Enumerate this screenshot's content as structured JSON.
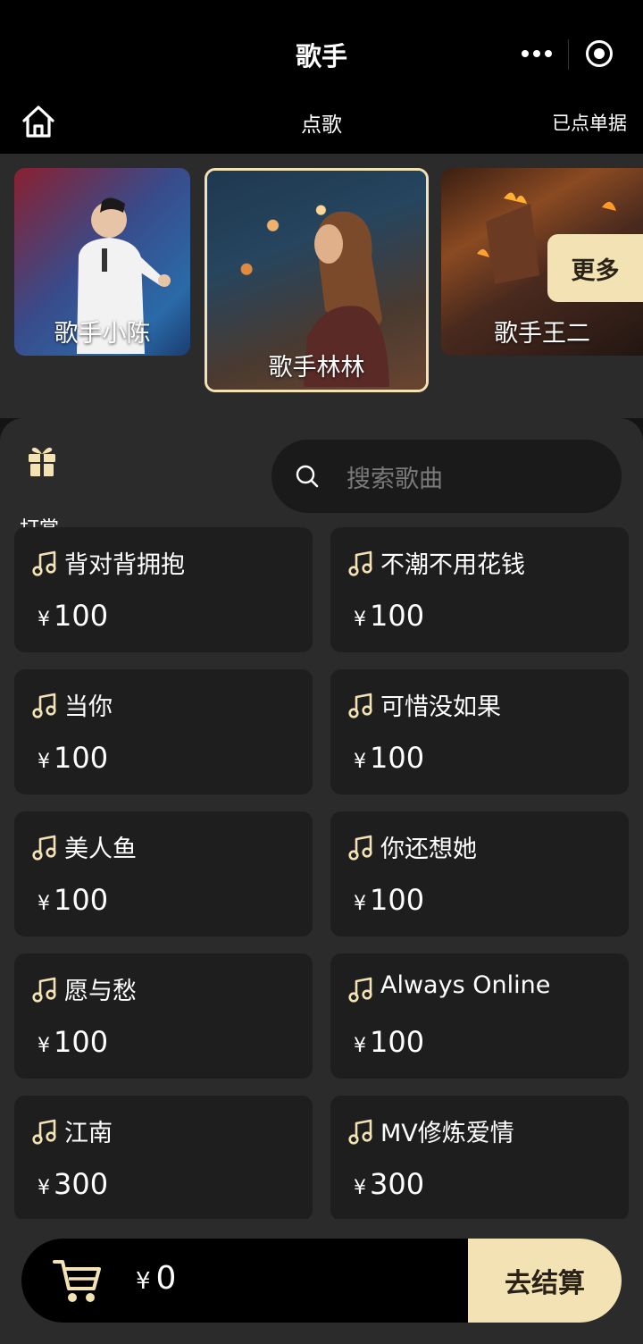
{
  "header": {
    "title": "歌手",
    "more_icon": "more-dots-icon",
    "close_icon": "target-icon"
  },
  "nav": {
    "home_icon": "home-icon",
    "title": "点歌",
    "orders_label": "已点单据"
  },
  "singers": [
    {
      "name": "歌手小陈",
      "selected": false
    },
    {
      "name": "歌手林林",
      "selected": true
    },
    {
      "name": "歌手王二",
      "selected": false
    }
  ],
  "more_label": "更多",
  "reward": {
    "label": "打赏",
    "icon": "gift-icon"
  },
  "search": {
    "placeholder": "搜索歌曲",
    "icon": "search-icon"
  },
  "songs": [
    {
      "title": "背对背拥抱",
      "currency": "¥",
      "price": "100"
    },
    {
      "title": "不潮不用花钱",
      "currency": "¥",
      "price": "100"
    },
    {
      "title": "当你",
      "currency": "¥",
      "price": "100"
    },
    {
      "title": "可惜没如果",
      "currency": "¥",
      "price": "100"
    },
    {
      "title": "美人鱼",
      "currency": "¥",
      "price": "100"
    },
    {
      "title": "你还想她",
      "currency": "¥",
      "price": "100"
    },
    {
      "title": "愿与愁",
      "currency": "¥",
      "price": "100"
    },
    {
      "title": "Always  Online",
      "currency": "¥",
      "price": "100"
    },
    {
      "title": "江南",
      "currency": "¥",
      "price": "300"
    },
    {
      "title": "MV修炼爱情",
      "currency": "¥",
      "price": "300"
    }
  ],
  "cart": {
    "icon": "cart-icon",
    "currency": "¥",
    "total": "0",
    "checkout_label": "去结算"
  },
  "colors": {
    "accent": "#f3e3b4",
    "background": "#141414",
    "card": "#1e1e1e",
    "panel": "#2b2b2b"
  }
}
